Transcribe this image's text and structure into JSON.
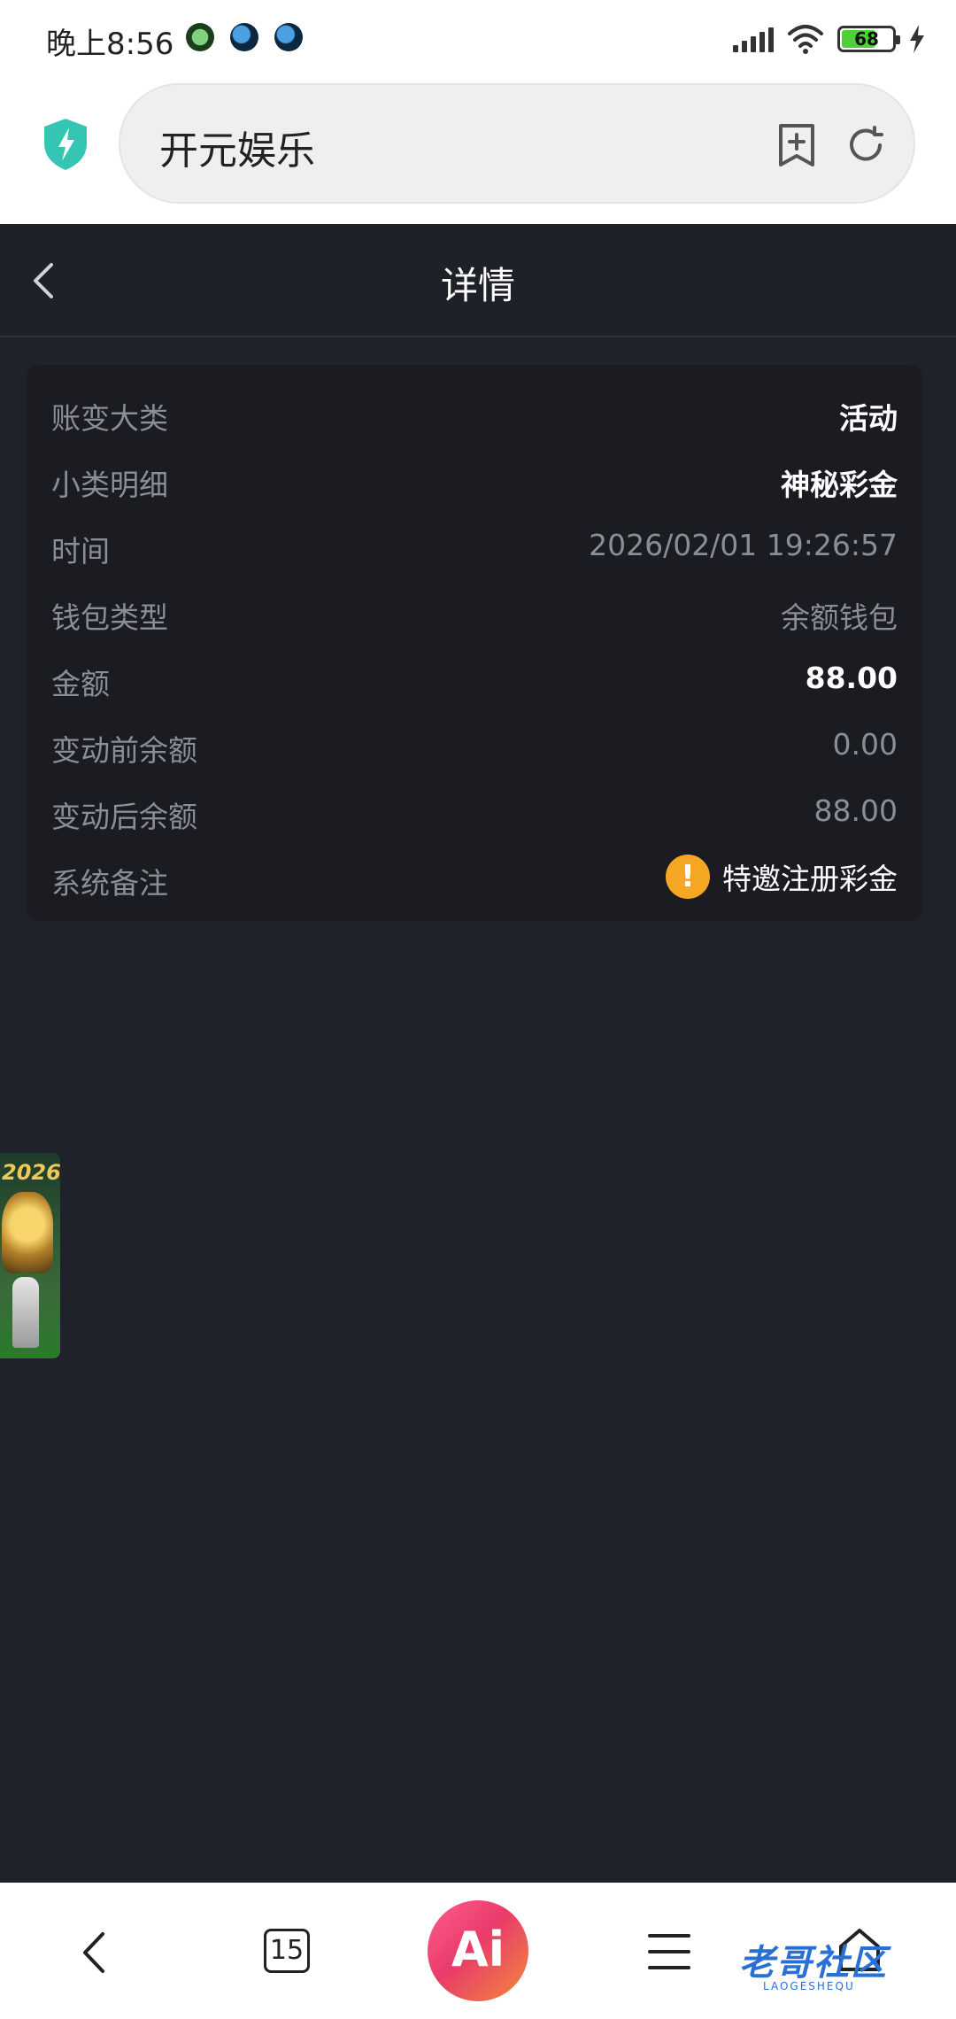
{
  "status_bar": {
    "time": "晚上8:56",
    "battery": "68"
  },
  "browser": {
    "address_text": "开元娱乐"
  },
  "header": {
    "title": "详情"
  },
  "details": {
    "rows": [
      {
        "label": "账变大类",
        "value": "活动"
      },
      {
        "label": "小类明细",
        "value": "神秘彩金"
      },
      {
        "label": "时间",
        "value": "2026/02/01 19:26:57"
      },
      {
        "label": "钱包类型",
        "value": "余额钱包"
      },
      {
        "label": "金额",
        "value": "88.00"
      },
      {
        "label": "变动前余额",
        "value": "0.00"
      },
      {
        "label": "变动后余额",
        "value": "88.00"
      },
      {
        "label": "系统备注",
        "value": "特邀注册彩金"
      }
    ]
  },
  "banner": {
    "year": "2026"
  },
  "bottom_nav": {
    "tabs_count": "15",
    "ai_label": "Ai"
  },
  "watermark": {
    "text": "老哥社区",
    "sub": "LAOGESHEQU"
  },
  "colors": {
    "page_bg": "#1f222a",
    "card_bg": "#1a1c21",
    "label_grey": "#8a8e97",
    "warning": "#f5a623",
    "ai_gradient_start": "#ff5e8a",
    "ai_gradient_end": "#f28a3a"
  },
  "icons": [
    "shield-icon",
    "bookmark-add-icon",
    "reload-icon",
    "back-icon",
    "warning-icon",
    "nav-back-icon",
    "tabs-icon",
    "menu-icon",
    "home-icon"
  ]
}
